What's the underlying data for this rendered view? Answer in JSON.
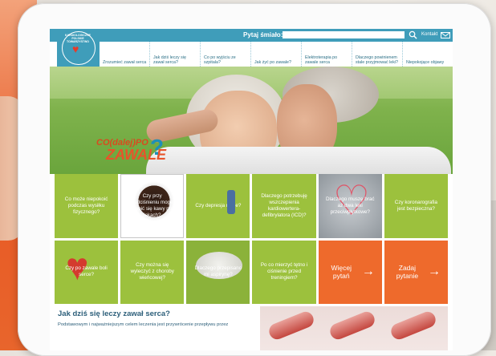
{
  "header": {
    "ask_label": "Pytaj śmiało:",
    "ask_placeholder": "",
    "contact_label": "Kontakt"
  },
  "logo": {
    "text": "KARDIOLOGICZNE POLSKIE TOWARZYSTWO"
  },
  "nav": {
    "items": [
      "Zrozumieć zawał serca",
      "Jak dziś leczy się zawał serca?",
      "Co po wyjściu ze szpitala?",
      "Jak żyć po zawale?",
      "Elektroterapia po zawale serca",
      "Dlaczego powinienem stale przyjmować leki?",
      "Niepokojące objawy"
    ]
  },
  "hero": {
    "logo_top": "CO(dalej)PO",
    "logo_bottom": "ZAWALE",
    "logo_q": "?"
  },
  "tiles": [
    {
      "text": "Co może niepokoić podczas wysiłku fizycznego?",
      "style": "green"
    },
    {
      "text": "Czy przy nadciśnieniu mogę napić się kawy po lekach?",
      "style": "coffee"
    },
    {
      "text": "Czy depresja minie?",
      "style": "green-figure"
    },
    {
      "text": "Dlaczego potrzebuję wszczepienia kardiowertera-defibrylatora (ICD)?",
      "style": "green"
    },
    {
      "text": "Dlaczego muszę brać aż dwa leki przeciwpłytkowe?",
      "style": "heart"
    },
    {
      "text": "Czy koronarografia jest bezpieczna?",
      "style": "green"
    },
    {
      "text": "Czy po zawale boli serce?",
      "style": "organ"
    },
    {
      "text": "Czy można się wyleczyć z choroby wieńcowej?",
      "style": "green"
    },
    {
      "text": "Dlaczego przepisano mi aspirynę?",
      "style": "pill"
    },
    {
      "text": "Po co mierzyć tętno i ciśnienie przed treningiem?",
      "style": "green"
    },
    {
      "text": "Więcej pytań",
      "style": "orange"
    },
    {
      "text": "Zadaj pytanie",
      "style": "orange"
    }
  ],
  "lower": {
    "title": "Jak dziś się leczy zawał serca?",
    "text": "Podstawowym i najważniejszym celem leczenia jest przywrócenie przepływu przez"
  },
  "colors": {
    "brand_blue": "#3f9dba",
    "tile_green": "#9cc13d",
    "tile_orange": "#ee6a2c"
  }
}
